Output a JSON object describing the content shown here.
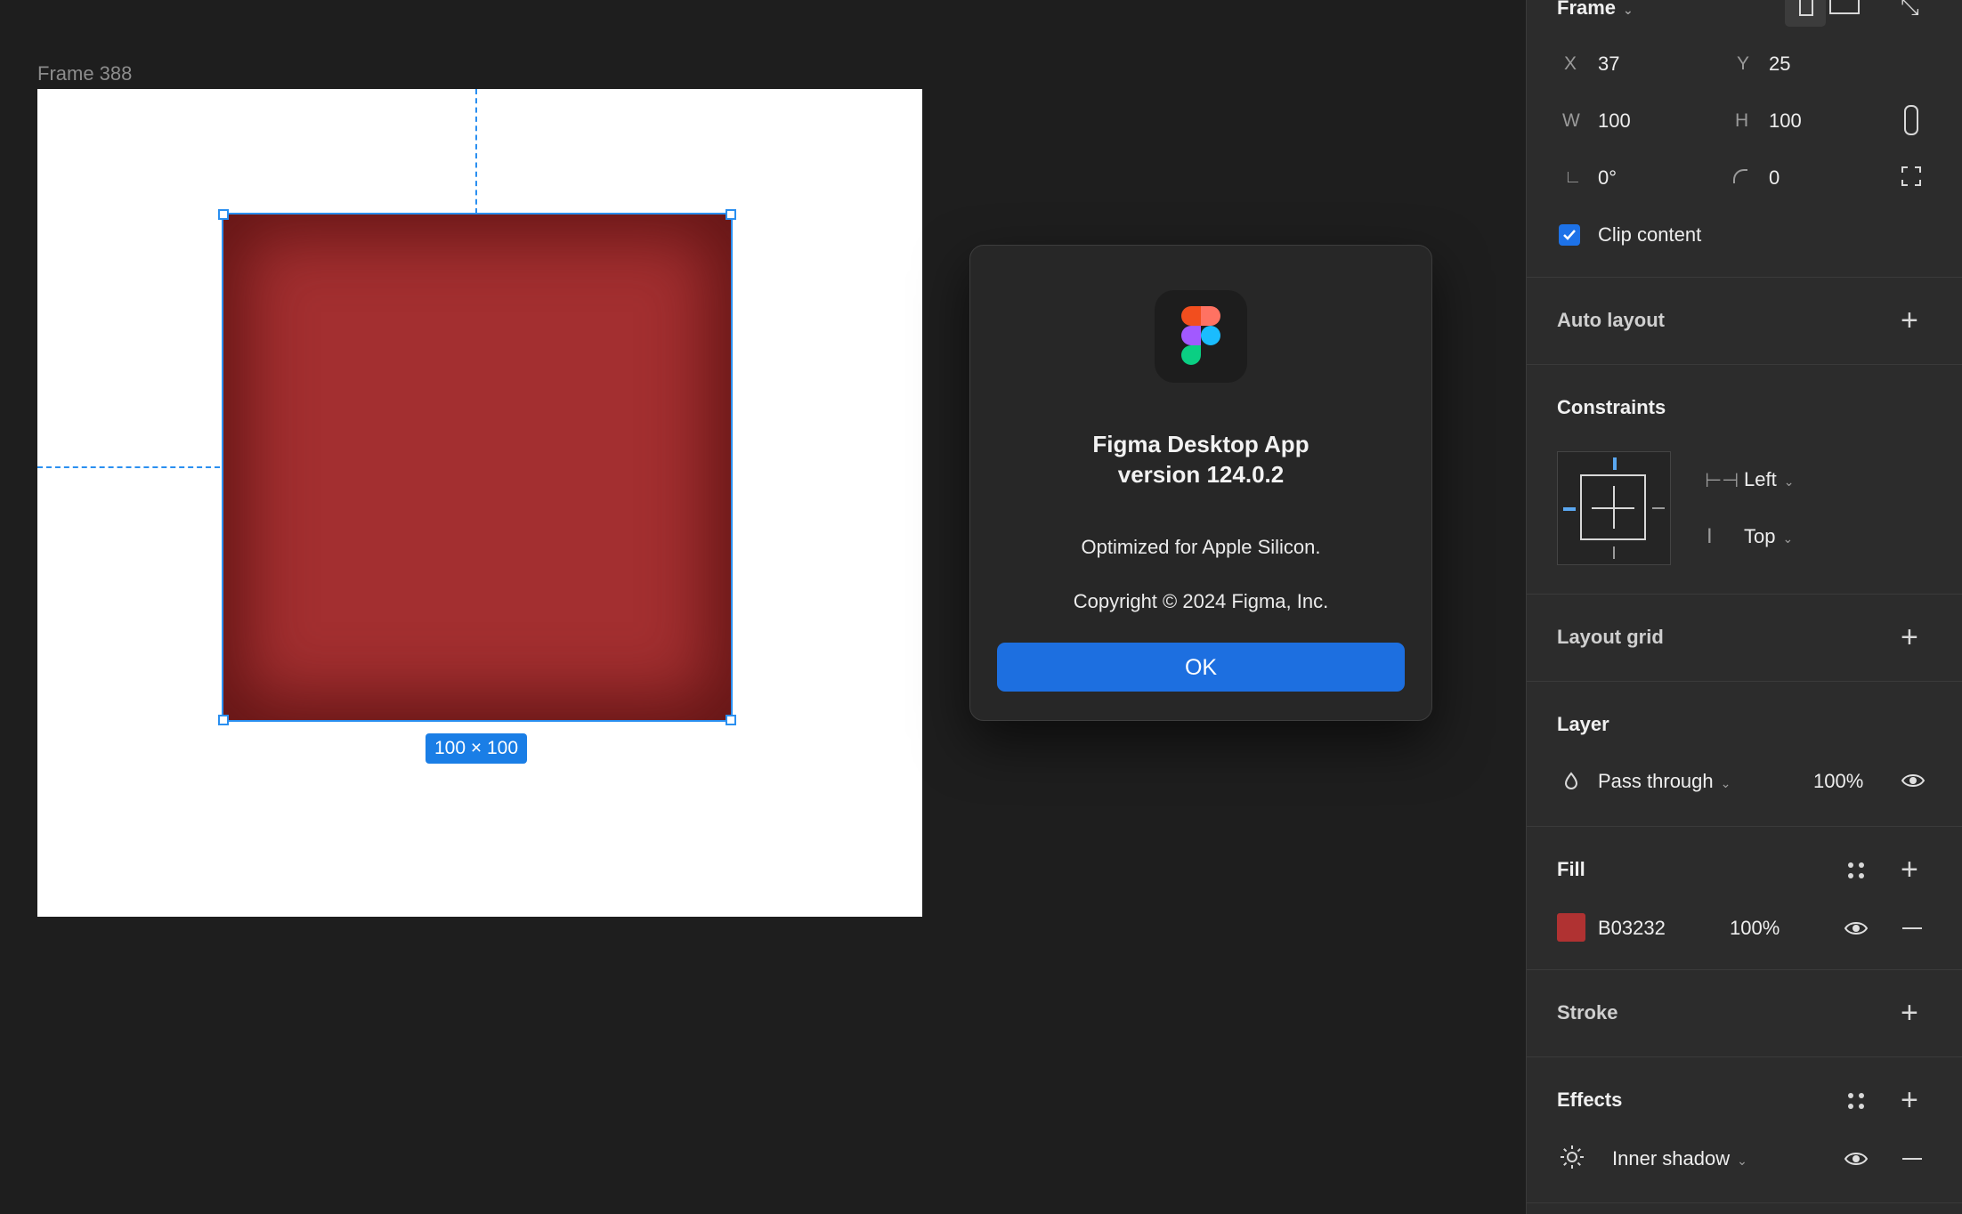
{
  "canvas": {
    "frame_label": "Frame 388",
    "selection_size": "100 × 100",
    "rect_color": "#A32F30"
  },
  "dialog": {
    "title_line1": "Figma Desktop App",
    "title_line2": "version 124.0.2",
    "optimized": "Optimized for Apple Silicon.",
    "copyright": "Copyright © 2024 Figma, Inc.",
    "ok_label": "OK",
    "icon": "figma-logo-icon"
  },
  "panel": {
    "frame": {
      "title": "Frame",
      "x_label": "X",
      "x": "37",
      "y_label": "Y",
      "y": "25",
      "w_label": "W",
      "w": "100",
      "h_label": "H",
      "h": "100",
      "rotation": "0°",
      "radius": "0",
      "clip_label": "Clip content",
      "clip_checked": true
    },
    "auto_layout": {
      "title": "Auto layout"
    },
    "constraints": {
      "title": "Constraints",
      "horizontal": "Left",
      "vertical": "Top"
    },
    "layout_grid": {
      "title": "Layout grid"
    },
    "layer": {
      "title": "Layer",
      "blend": "Pass through",
      "opacity": "100%"
    },
    "fill": {
      "title": "Fill",
      "hex": "B03232",
      "opacity": "100%",
      "swatch_color": "#B03232"
    },
    "stroke": {
      "title": "Stroke"
    },
    "effects": {
      "title": "Effects",
      "effect": "Inner shadow"
    }
  }
}
